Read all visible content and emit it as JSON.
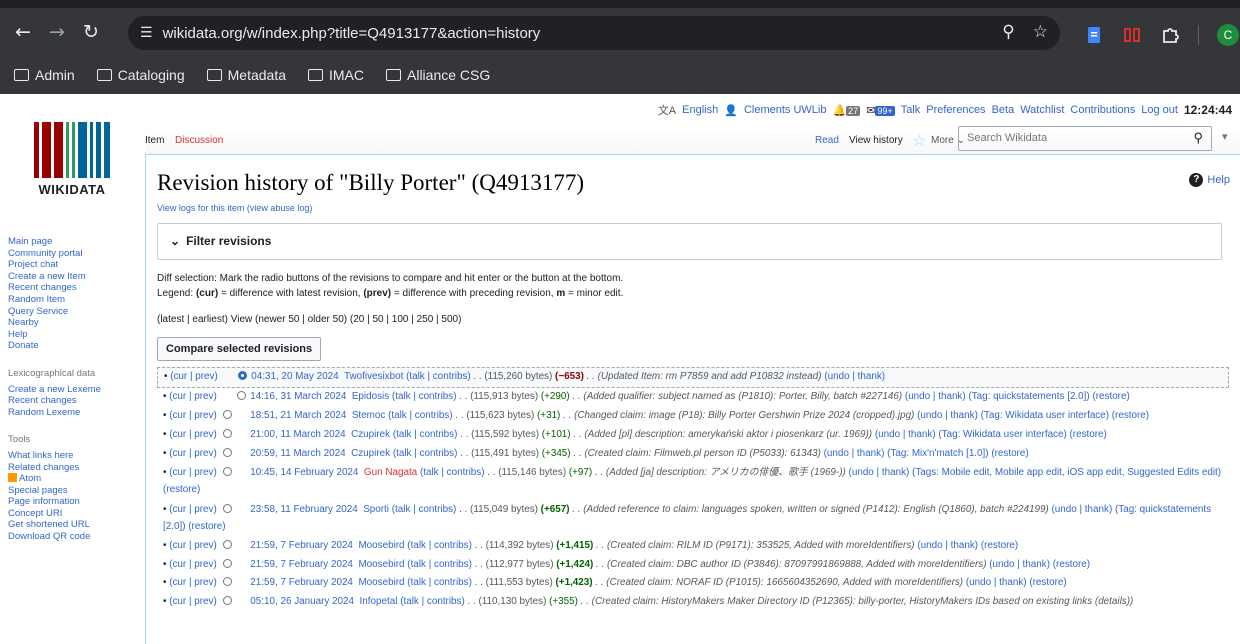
{
  "browser": {
    "url": "wikidata.org/w/index.php?title=Q4913177&action=history",
    "bookmarks": [
      "Admin",
      "Cataloging",
      "Metadata",
      "IMAC",
      "Alliance CSG"
    ],
    "profile_initial": "C"
  },
  "usertools": {
    "language": "English",
    "username": "Clements UWLib",
    "alerts_count": "27",
    "notices_count": "99+",
    "links": [
      "Talk",
      "Preferences",
      "Beta",
      "Watchlist",
      "Contributions",
      "Log out"
    ],
    "time": "12:24:44"
  },
  "logo": {
    "wordmark": "WIKIDATA"
  },
  "tabs": {
    "left": [
      "Item",
      "Discussion"
    ],
    "right": [
      "Read",
      "View history"
    ],
    "more": "More",
    "search_placeholder": "Search Wikidata"
  },
  "sidebar": {
    "main": [
      "Main page",
      "Community portal",
      "Project chat",
      "Create a new Item",
      "Recent changes",
      "Random Item",
      "Query Service",
      "Nearby",
      "Help",
      "Donate"
    ],
    "lexeme_heading": "Lexicographical data",
    "lexeme": [
      "Create a new Lexeme",
      "Recent changes",
      "Random Lexeme"
    ],
    "tools_heading": "Tools",
    "tools": [
      "What links here",
      "Related changes",
      "Atom",
      "Special pages",
      "Page information",
      "Concept URI",
      "Get shortened URL",
      "Download QR code"
    ]
  },
  "main": {
    "title": "Revision history of \"Billy Porter\" (Q4913177)",
    "help": "Help",
    "view_logs": "View logs for this item (view abuse log)",
    "filter_label": "Filter revisions",
    "diff_selection": "Diff selection: Mark the radio buttons of the revisions to compare and hit enter or the button at the bottom.",
    "legend": {
      "prefix": "Legend: ",
      "cur": "(cur)",
      "cur_text": " = difference with latest revision, ",
      "prev": "(prev)",
      "prev_text": " = difference with preceding revision, ",
      "m": "m",
      "m_text": " = minor edit."
    },
    "pager": "(latest | earliest) View (newer 50 | older 50) (20 | 50 | 100 | 250 | 500)",
    "compare_button": "Compare selected revisions"
  },
  "revisions": [
    {
      "links": "(cur | prev)",
      "radio1": "none",
      "radio2": "on",
      "date": "04:31, 20 May 2024",
      "user": "Twofivesixbot",
      "user_red": false,
      "tools": "(talk | contribs)",
      "size": ". . (115,260 bytes)",
      "delta": "(−653)",
      "delta_class": "neg",
      "comment": ". . (Updated Item: rm P7859 and add P10832 instead)",
      "tail": "(undo | thank)"
    },
    {
      "links": "(cur | prev)",
      "radio1": "none",
      "radio2": "off",
      "date": "14:16, 31 March 2024",
      "user": "Epidosis",
      "user_red": false,
      "tools": "(talk | contribs)",
      "size": ". . (115,913 bytes)",
      "delta": "(+290)",
      "delta_class": "pos",
      "comment": ". . (Added qualifier: subject named as (P1810): Porter, Billy, batch #227146)",
      "tail": "(undo | thank) (Tag: quickstatements [2.0]) (restore)"
    },
    {
      "links": "(cur | prev)",
      "radio1": "off",
      "radio2": "none",
      "date": "18:51, 21 March 2024",
      "user": "Stemoc",
      "user_red": false,
      "tools": "(talk | contribs)",
      "size": ". . (115,623 bytes)",
      "delta": "(+31)",
      "delta_class": "pos",
      "comment": ". . (Changed claim: image (P18): Billy Porter Gershwin Prize 2024 (cropped).jpg)",
      "tail": "(undo | thank) (Tag: Wikidata user interface) (restore)"
    },
    {
      "links": "(cur | prev)",
      "radio1": "off",
      "radio2": "none",
      "date": "21:00, 11 March 2024",
      "user": "Czupirek",
      "user_red": false,
      "tools": "(talk | contribs)",
      "size": ". . (115,592 bytes)",
      "delta": "(+101)",
      "delta_class": "pos",
      "comment": ". . (Added [pl] description: amerykański aktor i piosenkarz (ur. 1969))",
      "tail": "(undo | thank) (Tag: Wikidata user interface) (restore)"
    },
    {
      "links": "(cur | prev)",
      "radio1": "off",
      "radio2": "none",
      "date": "20:59, 11 March 2024",
      "user": "Czupirek",
      "user_red": false,
      "tools": "(talk | contribs)",
      "size": ". . (115,491 bytes)",
      "delta": "(+345)",
      "delta_class": "pos",
      "comment": ". . (Created claim: Filmweb.pl person ID (P5033): 61343)",
      "tail": "(undo | thank) (Tag: Mix'n'match [1.0]) (restore)"
    },
    {
      "links": "(cur | prev)",
      "radio1": "off",
      "radio2": "none",
      "date": "10:45, 14 February 2024",
      "user": "Gun Nagata",
      "user_red": true,
      "tools": "(talk | contribs)",
      "size": ". . (115,146 bytes)",
      "delta": "(+97)",
      "delta_class": "pos",
      "comment": ". . (Added [ja] description: アメリカの俳優、歌手 (1969-))",
      "tail": "(undo | thank) (Tags: Mobile edit, Mobile app edit, iOS app edit, Suggested Edits edit) (restore)"
    },
    {
      "links": "(cur | prev)",
      "radio1": "off",
      "radio2": "none",
      "date": "23:58, 11 February 2024",
      "user": "Sporti",
      "user_red": false,
      "tools": "(talk | contribs)",
      "size": ". . (115,049 bytes)",
      "delta": "(+657)",
      "delta_class": "pos bold",
      "comment": ". . (Added reference to claim: languages spoken, written or signed (P1412): English (Q1860), batch #224199)",
      "tail": "(undo | thank) (Tag: quickstatements [2.0]) (restore)"
    },
    {
      "links": "(cur | prev)",
      "radio1": "off",
      "radio2": "none",
      "date": "21:59, 7 February 2024",
      "user": "Moosebird",
      "user_red": false,
      "tools": "(talk | contribs)",
      "size": ". . (114,392 bytes)",
      "delta": "(+1,415)",
      "delta_class": "pos bold",
      "comment": ". . (Created claim: RILM ID (P9171): 353525, Added with moreIdentifiers)",
      "tail": "(undo | thank) (restore)"
    },
    {
      "links": "(cur | prev)",
      "radio1": "off",
      "radio2": "none",
      "date": "21:59, 7 February 2024",
      "user": "Moosebird",
      "user_red": false,
      "tools": "(talk | contribs)",
      "size": ". . (112,977 bytes)",
      "delta": "(+1,424)",
      "delta_class": "pos bold",
      "comment": ". . (Created claim: DBC author ID (P3846): 87097991869888, Added with moreIdentifiers)",
      "tail": "(undo | thank) (restore)"
    },
    {
      "links": "(cur | prev)",
      "radio1": "off",
      "radio2": "none",
      "date": "21:59, 7 February 2024",
      "user": "Moosebird",
      "user_red": false,
      "tools": "(talk | contribs)",
      "size": ". . (111,553 bytes)",
      "delta": "(+1,423)",
      "delta_class": "pos bold",
      "comment": ". . (Created claim: NORAF ID (P1015): 1665604352690, Added with moreIdentifiers)",
      "tail": "(undo | thank) (restore)"
    },
    {
      "links": "(cur | prev)",
      "radio1": "off",
      "radio2": "none",
      "date": "05:10, 26 January 2024",
      "user": "Infopetal",
      "user_red": false,
      "tools": "(talk | contribs)",
      "size": ". . (110,130 bytes)",
      "delta": "(+355)",
      "delta_class": "pos",
      "comment": ". . (Created claim: HistoryMakers Maker Directory ID (P12365): billy-porter, HistoryMakers IDs based on existing links (details))",
      "tail": ""
    }
  ]
}
